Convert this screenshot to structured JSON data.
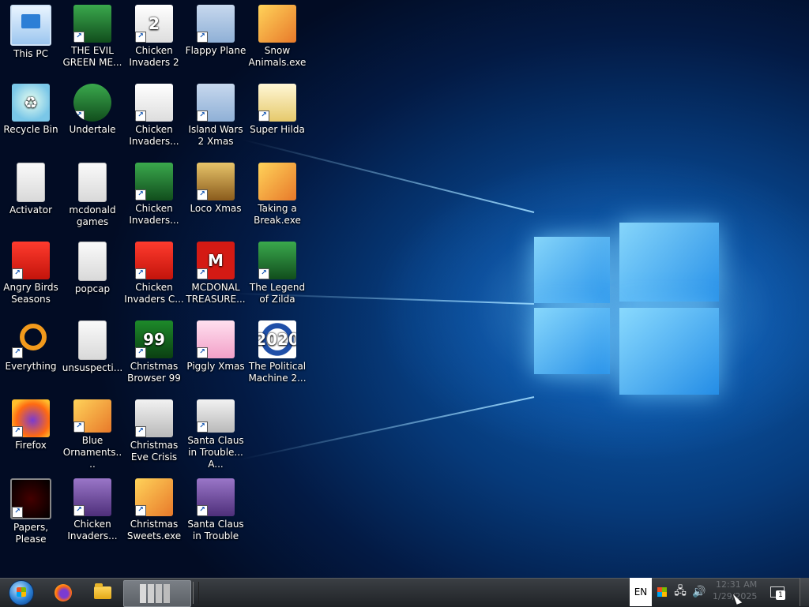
{
  "desktop": {
    "icons": [
      {
        "label": "This PC"
      },
      {
        "label": "Recycle Bin"
      },
      {
        "label": "Activator"
      },
      {
        "label": "Angry Birds Seasons"
      },
      {
        "label": "Everything"
      },
      {
        "label": "Firefox"
      },
      {
        "label": "Papers, Please"
      },
      {
        "label": "THE EVIL GREEN ME..."
      },
      {
        "label": "Undertale"
      },
      {
        "label": "mcdonald games"
      },
      {
        "label": "popcap"
      },
      {
        "label": "unsuspecti..."
      },
      {
        "label": "Blue Ornaments...."
      },
      {
        "label": "Chicken Invaders..."
      },
      {
        "label": "Chicken Invaders 2"
      },
      {
        "label": "Chicken Invaders..."
      },
      {
        "label": "Chicken Invaders..."
      },
      {
        "label": "Chicken Invaders C..."
      },
      {
        "label": "Christmas Browser 99"
      },
      {
        "label": "Christmas Eve Crisis"
      },
      {
        "label": "Christmas Sweets.exe"
      },
      {
        "label": "Flappy Plane"
      },
      {
        "label": "Island Wars 2 Xmas"
      },
      {
        "label": "Loco Xmas"
      },
      {
        "label": "MCDONAL TREASURE..."
      },
      {
        "label": "Piggly Xmas"
      },
      {
        "label": "Santa Claus in Trouble... A..."
      },
      {
        "label": "Santa Claus in Trouble"
      },
      {
        "label": "Snow Animals.exe"
      },
      {
        "label": "Super Hilda"
      },
      {
        "label": "Taking a Break.exe"
      },
      {
        "label": "The Legend of Zilda"
      },
      {
        "label": "The Political Machine 2..."
      }
    ],
    "icon_glyphs": {
      "chicken2": "2",
      "christmas99": "99",
      "political": "2020",
      "mcd": "M"
    }
  },
  "taskbar": {
    "language": "EN",
    "clock_time": "12:31 AM",
    "clock_date": "1/29/2025",
    "notification_count": "1"
  }
}
